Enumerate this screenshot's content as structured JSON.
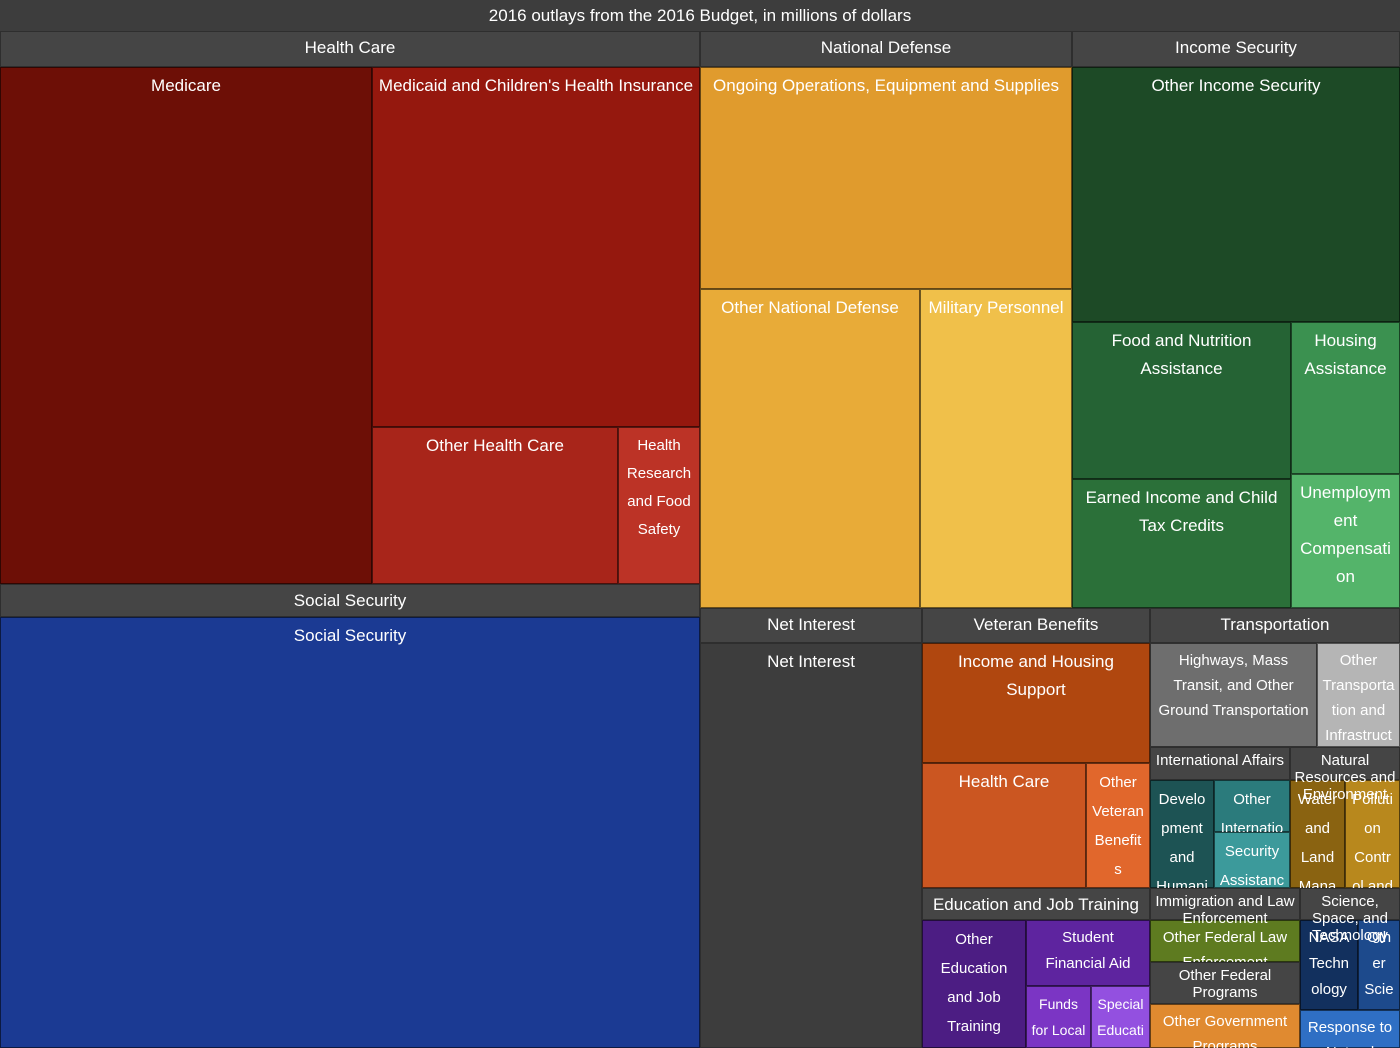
{
  "title": "2016 outlays from the 2016 Budget, in millions of dollars",
  "chart_data": {
    "type": "treemap",
    "title": "2016 outlays from the 2016 Budget, in millions of dollars",
    "value_units": "millions of dollars",
    "groups": [
      {
        "name": "Health Care",
        "color": "#7b1005",
        "children": [
          {
            "name": "Medicare",
            "color": "#6d0f06"
          },
          {
            "name": "Medicaid and Children's Health Insurance",
            "color": "#95180e"
          },
          {
            "name": "Other Health Care",
            "color": "#a8251a"
          },
          {
            "name": "Health Research and Food Safety",
            "color": "#bc3326"
          }
        ]
      },
      {
        "name": "National Defense",
        "color": "#e09b2d",
        "children": [
          {
            "name": "Ongoing Operations, Equipment and Supplies",
            "color": "#e09b2d"
          },
          {
            "name": "Other National Defense",
            "color": "#e8ab38"
          },
          {
            "name": "Military Personnel",
            "color": "#f0c04a"
          }
        ]
      },
      {
        "name": "Income Security",
        "color": "#1d4a26",
        "children": [
          {
            "name": "Other Income Security",
            "color": "#1d4a26"
          },
          {
            "name": "Food and Nutrition Assistance",
            "color": "#256334"
          },
          {
            "name": "Earned Income and Child Tax Credits",
            "color": "#2b7039"
          },
          {
            "name": "Housing Assistance",
            "color": "#3b9150"
          },
          {
            "name": "Unemployment Compensation",
            "color": "#54b46a"
          }
        ]
      },
      {
        "name": "Social Security",
        "color": "#1b3a93",
        "children": [
          {
            "name": "Social Security",
            "color": "#1b3a93"
          }
        ]
      },
      {
        "name": "Net Interest",
        "color": "#3d3d3d",
        "children": [
          {
            "name": "Net Interest",
            "color": "#3d3d3d"
          }
        ]
      },
      {
        "name": "Veteran Benefits",
        "color": "#b0470f",
        "children": [
          {
            "name": "Income and Housing Support",
            "color": "#b0470f"
          },
          {
            "name": "Health Care",
            "color": "#cb5621"
          },
          {
            "name": "Other Veteran Benefits",
            "color": "#e1672c"
          }
        ]
      },
      {
        "name": "Transportation",
        "color": "#6e6e6e",
        "children": [
          {
            "name": "Highways, Mass Transit, and Other Ground Transportation",
            "color": "#6e6e6e"
          },
          {
            "name": "Other Transportation and Infrastructure",
            "color": "#b5b5b5"
          }
        ]
      },
      {
        "name": "Education and Job Training",
        "color": "#4c1d83",
        "children": [
          {
            "name": "Other Education and Job Training",
            "color": "#4c1d83"
          },
          {
            "name": "Student Financial Aid",
            "color": "#5e249f"
          },
          {
            "name": "Funds for Local Schools",
            "color": "#7b35c4"
          },
          {
            "name": "Special Education",
            "color": "#9350e0"
          }
        ]
      },
      {
        "name": "International Affairs",
        "color": "#1d5354",
        "children": [
          {
            "name": "Development and Humanitarian Assistance",
            "color": "#1d5354"
          },
          {
            "name": "Other International Affairs",
            "color": "#2b7b7c"
          },
          {
            "name": "Security Assistance",
            "color": "#3c9a9b"
          }
        ]
      },
      {
        "name": "Natural Resources and Environment",
        "color": "#8a6311",
        "children": [
          {
            "name": "Water and Land Management",
            "color": "#8a6311"
          },
          {
            "name": "Pollution Control and Other",
            "color": "#b8881d"
          }
        ]
      },
      {
        "name": "Immigration and Law Enforcement",
        "color": "#5e7b20",
        "children": [
          {
            "name": "Other Federal Law Enforcement",
            "color": "#5e7b20"
          }
        ]
      },
      {
        "name": "Science, Space, and Technology",
        "color": "#12305e",
        "children": [
          {
            "name": "NASA Technology Programs",
            "color": "#12305e"
          },
          {
            "name": "Other Science",
            "color": "#1d4a8c"
          },
          {
            "name": "Response to Natural Disasters",
            "color": "#2f6fc4"
          }
        ]
      },
      {
        "name": "Other Federal Programs",
        "color": "#e08a30",
        "children": [
          {
            "name": "Other Government Programs",
            "color": "#e08a30"
          }
        ]
      }
    ]
  },
  "headers": {
    "health_care": "Health Care",
    "national_defense": "National Defense",
    "income_security": "Income Security",
    "social_security": "Social Security",
    "net_interest": "Net Interest",
    "veteran_benefits": "Veteran Benefits",
    "transportation": "Transportation",
    "education": "Education and Job Training",
    "international": "International Affairs",
    "natural_resources": "Natural Resources and Environment",
    "immigration": "Immigration and Law Enforcement",
    "science": "Science, Space, and Technology",
    "other_federal": "Other Federal Programs",
    "other_gov": "Other Government Programs"
  },
  "cells": {
    "medicare": "Medicare",
    "medicaid": "Medicaid and Children's Health Insurance",
    "other_health_care": "Other Health Care",
    "health_research": "Health Research and Food Safety",
    "ongoing_ops": "Ongoing Operations, Equipment and Supplies",
    "other_national_defense": "Other National Defense",
    "military_personnel": "Military Personnel",
    "other_income_security": "Other Income Security",
    "food_nutrition": "Food and Nutrition Assistance",
    "earned_income": "Earned Income and Child Tax Credits",
    "housing_assistance": "Housing Assistance",
    "unemployment": "Unemployment Compensation",
    "social_security": "Social Security",
    "net_interest": "Net Interest",
    "income_housing_support": "Income and Housing Support",
    "vet_health_care": "Health Care",
    "other_veteran_benefits": "Other Veteran Benefits",
    "highways": "Highways, Mass Transit, and Other Ground Transportation",
    "other_transportation": "Other Transportation and Infrastructure",
    "other_education": "Other Education and Job Training",
    "student_financial_aid": "Student Financial Aid",
    "funds_local_schools": "Funds for Local Schools",
    "special_education": "Special Education",
    "development_humanitarian": "Development and Humanitarian Assistance",
    "other_international": "Other International Affairs",
    "security_assistance": "Security Assistance",
    "water_land": "Water and Land Management",
    "pollution_control": "Pollution Control and Other",
    "other_law_enforcement": "Other Federal Law Enforcement",
    "nasa": "NASA Technology Programs",
    "other_science": "Other Science",
    "disaster_response": "Response to Natural Disasters",
    "other_gov_programs": "Other Government Programs"
  }
}
